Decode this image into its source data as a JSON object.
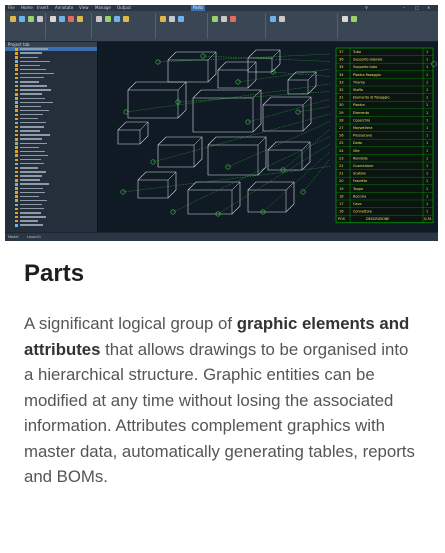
{
  "screenshot": {
    "alt": "Parts and attributes editing in a CAD application",
    "title_text": "Project tab",
    "status_text": "Model",
    "status_tab": "Layout1",
    "table_rows": [
      {
        "n": "37",
        "desc": "Tubo"
      },
      {
        "n": "36",
        "desc": "Supporto laterale"
      },
      {
        "n": "35",
        "desc": "Supporto tubo"
      },
      {
        "n": "34",
        "desc": "Piastra fissaggio"
      },
      {
        "n": "33",
        "desc": "Tirante"
      },
      {
        "n": "32",
        "desc": "Staffa"
      },
      {
        "n": "31",
        "desc": "Elemento di fissaggio"
      },
      {
        "n": "30",
        "desc": "Piastra"
      },
      {
        "n": "29",
        "desc": "Elemento"
      },
      {
        "n": "28",
        "desc": "Coperchio"
      },
      {
        "n": "27",
        "desc": "Morsettiera"
      },
      {
        "n": "26",
        "desc": "Pressacavo"
      },
      {
        "n": "25",
        "desc": "Dado"
      },
      {
        "n": "24",
        "desc": "Vite"
      },
      {
        "n": "23",
        "desc": "Rondella"
      },
      {
        "n": "22",
        "desc": "Guarnizione"
      },
      {
        "n": "21",
        "desc": "Scatola"
      },
      {
        "n": "20",
        "desc": "Fascetta"
      },
      {
        "n": "19",
        "desc": "Tappo"
      },
      {
        "n": "18",
        "desc": "Boccola"
      },
      {
        "n": "17",
        "desc": "Cavo"
      },
      {
        "n": "16",
        "desc": "Connettore"
      }
    ],
    "table_header": {
      "pos": "POS",
      "desc": "DESCRIZIONE",
      "qty": "Q.TA"
    },
    "colors": {
      "cad_background": "#0f1a24",
      "table_border": "#00c000",
      "table_text": "#f0e060",
      "leader_lines": "#3fc93f"
    }
  },
  "content": {
    "heading": "Parts",
    "description_pre": "A significant logical group of ",
    "description_bold": "graphic elements and attributes",
    "description_post": " that allows drawings to be organised into a hierarchical structure. Graphic entities can be modified at any time without losing the associated information. Attributes complement graphics with master data, automatically generating tables, reports and BOMs."
  }
}
